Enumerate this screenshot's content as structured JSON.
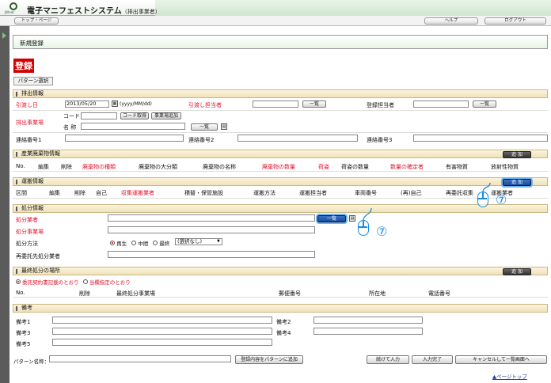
{
  "header": {
    "app_title": "電子マニフェストシステム",
    "app_subtitle": "（排出事業者）",
    "logo_text": "JWnet",
    "tab_top": "トップ・ページ",
    "tab_help": "ヘルプ",
    "tab_logout": "ログアウト"
  },
  "page": {
    "title": "新規登録",
    "register_label": "登録",
    "pattern_tab": "パターン選択"
  },
  "discharge": {
    "section": "排出情報",
    "hikiwatashi_date_label": "引渡し日",
    "date_value": "2013/05/20",
    "date_format": "(yyyy/MM/dd)",
    "tantou_label": "引渡し担当者",
    "touroku_label": "登録担当者",
    "ichiran": "一覧",
    "jigyojo_label": "排出事業場",
    "code_label": "コード",
    "name_label": "名 称",
    "code_btn": "コード取得",
    "jigyojo_btn": "事業場追加",
    "renraku1": "連絡番号1",
    "renraku2": "連絡番号2",
    "renraku3": "連絡番号3"
  },
  "waste": {
    "section": "産業廃棄物情報",
    "add": "追 加",
    "cols": [
      "No.",
      "編集",
      "削除",
      "廃棄物の種類",
      "廃棄物の大分類",
      "廃棄物の名称",
      "廃棄物の数量",
      "荷姿",
      "荷姿の数量",
      "数量の確定者",
      "有害物質",
      "放射性物質"
    ]
  },
  "transport": {
    "section": "運搬情報",
    "add": "追 加",
    "cols": [
      "区間",
      "編集",
      "削除",
      "自己",
      "収集運搬業者",
      "積替・保管施設",
      "運搬方法",
      "運搬担当者",
      "車両番号",
      "(再)自己",
      "再委託収集",
      "運搬業者"
    ]
  },
  "disposal": {
    "section": "処分情報",
    "gyosha_label": "処分業者",
    "jigyojo_label": "処分事業場",
    "method_label": "処分方法",
    "method_options": [
      "再生",
      "中間",
      "最終"
    ],
    "method_select": "(選択なし)",
    "reitaku_label": "再委託先処分業者",
    "ichiran": "一覧"
  },
  "final": {
    "section": "最終処分の場所",
    "add": "追 加",
    "opt1": "委託契約書記載のとおり",
    "opt2": "当欄指定のとおり",
    "cols": [
      "No.",
      "削除",
      "最終処分事業場",
      "郵便番号",
      "所在地",
      "電話番号"
    ]
  },
  "remarks": {
    "section": "備考",
    "labels": [
      "備考1",
      "備考2",
      "備考3",
      "備考4",
      "備考5"
    ]
  },
  "footer": {
    "pattern_name_label": "パターン名称：",
    "save_pattern": "登録内容をパターンに追加",
    "continue": "続けて入力",
    "complete": "入力完了",
    "cancel": "キャンセルして一覧画面へ",
    "page_top": "ページトップ"
  },
  "annotations": {
    "step": "⑦"
  }
}
